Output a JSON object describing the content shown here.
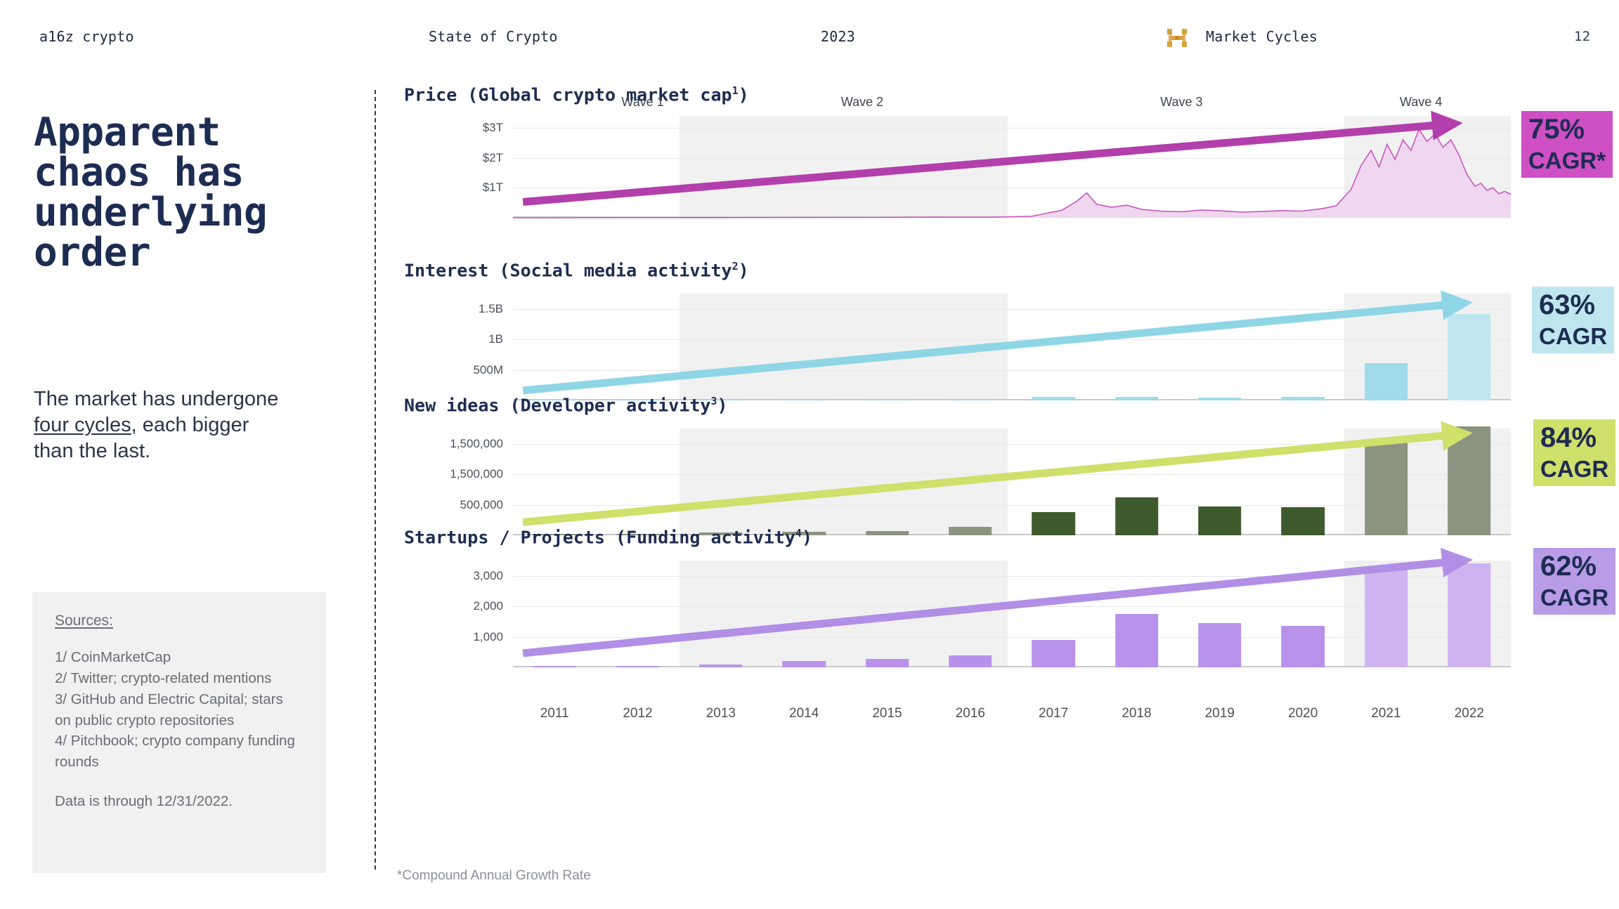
{
  "header": {
    "brand": "a16z crypto",
    "deck": "State of Crypto",
    "year": "2023",
    "section": "Market Cycles",
    "page": "12",
    "logo_icon": "a16z-butterfly-logo-icon",
    "logo_color": "#d8a13f"
  },
  "left": {
    "headline": "Apparent chaos has underlying order",
    "subcopy_pre": "The market has undergone ",
    "subcopy_link": "four cycles",
    "subcopy_post": ", each bigger than the last.",
    "sources_title": "Sources:",
    "sources_list": "1/ CoinMarketCap\n2/ Twitter; crypto-related mentions\n3/ GitHub and Electric Capital; stars on public crypto repositories\n4/ Pitchbook; crypto company funding rounds",
    "sources_note": "Data is through 12/31/2022."
  },
  "footnote": "*Compound Annual Growth Rate",
  "waves": [
    {
      "label": "Wave 1",
      "center_pct": 13.0,
      "shaded": false
    },
    {
      "label": "Wave 2",
      "center_pct": 35.0,
      "shaded": true
    },
    {
      "label": "Wave 3",
      "center_pct": 67.0,
      "shaded": false
    },
    {
      "label": "Wave 4",
      "center_pct": 91.0,
      "shaded": true
    }
  ],
  "xaxis": {
    "categories": [
      "2011",
      "2012",
      "2013",
      "2014",
      "2015",
      "2016",
      "2017",
      "2018",
      "2019",
      "2020",
      "2021",
      "2022"
    ]
  },
  "chart_data": [
    {
      "type": "area",
      "key": "price",
      "title": "Price (Global crypto market cap",
      "title_sup": "1",
      "title_suffix": ")",
      "ylabel": "",
      "yticks": [
        "$3T",
        "$2T",
        "$1T"
      ],
      "ytick_values": [
        3,
        2,
        1
      ],
      "ylim": [
        0,
        3.4
      ],
      "badge": {
        "pct": "75%",
        "cagr": "CAGR*",
        "bg": "#cf4fc4",
        "fg": "#1d2c52"
      },
      "series_color": "#c758be",
      "fill_color": "#f0d6ef",
      "trend_color": "#b23fab",
      "x": [
        "2011",
        "2012",
        "2013",
        "2014",
        "2015",
        "2016",
        "2017",
        "2018",
        "2019",
        "2020",
        "2021",
        "2022"
      ],
      "values_trillions": [
        0.0,
        0.0,
        0.01,
        0.01,
        0.01,
        0.02,
        0.6,
        0.13,
        0.19,
        0.77,
        2.9,
        0.83
      ],
      "peaks": {
        "2018_jan": 0.83,
        "2021_nov": 3.0,
        "2022_dec": 0.83
      }
    },
    {
      "type": "bar",
      "key": "interest",
      "title": "Interest (Social media activity",
      "title_sup": "2",
      "title_suffix": ")",
      "yticks": [
        "1.5B",
        "1B",
        "500M"
      ],
      "ytick_values": [
        1500000000,
        1000000000,
        500000000
      ],
      "ylim": [
        0,
        1750000000
      ],
      "badge": {
        "pct": "63%",
        "cagr": "CAGR",
        "bg": "#bfe6ee",
        "fg": "#1d2c52"
      },
      "bar_color": "#9fdbe8",
      "bar_color_alt": "#bfe6ee",
      "trend_color": "#8ed6e6",
      "categories": [
        "2011",
        "2012",
        "2013",
        "2014",
        "2015",
        "2016",
        "2017",
        "2018",
        "2019",
        "2020",
        "2021",
        "2022"
      ],
      "values": [
        2000000,
        3000000,
        5000000,
        8000000,
        12000000,
        20000000,
        55000000,
        62000000,
        45000000,
        58000000,
        610000000,
        1420000000
      ]
    },
    {
      "type": "bar",
      "key": "new_ideas",
      "title": "New ideas (Developer activity",
      "title_sup": "3",
      "title_suffix": ")",
      "yticks": [
        "1,500,000",
        "1,500,000",
        "500,000"
      ],
      "ytick_values": [
        1500000,
        1000000,
        500000
      ],
      "ylim": [
        0,
        1750000
      ],
      "badge": {
        "pct": "84%",
        "cagr": "CAGR",
        "bg": "#cfe06b",
        "fg": "#1d2c52"
      },
      "bar_color": "#3f5a2c",
      "bar_color_alt": "#8b9480",
      "trend_color": "#cfe06b",
      "categories": [
        "2011",
        "2012",
        "2013",
        "2014",
        "2015",
        "2016",
        "2017",
        "2018",
        "2019",
        "2020",
        "2021",
        "2022"
      ],
      "values": [
        10000,
        25000,
        45000,
        55000,
        75000,
        135000,
        375000,
        620000,
        470000,
        455000,
        1560000,
        1780000
      ]
    },
    {
      "type": "bar",
      "key": "startups",
      "title": "Startups / Projects (Funding activity",
      "title_sup": "4",
      "title_suffix": ")",
      "yticks": [
        "3,000",
        "2,000",
        "1,000"
      ],
      "ytick_values": [
        3000,
        2000,
        1000
      ],
      "ylim": [
        0,
        3500
      ],
      "badge": {
        "pct": "62%",
        "cagr": "CAGR",
        "bg": "#b89ce8",
        "fg": "#1d2c52"
      },
      "bar_color": "#b892ea",
      "bar_color_alt": "#cdb3f0",
      "trend_color": "#b18fe6",
      "categories": [
        "2011",
        "2012",
        "2013",
        "2014",
        "2015",
        "2016",
        "2017",
        "2018",
        "2019",
        "2020",
        "2021",
        "2022"
      ],
      "values": [
        20,
        40,
        90,
        200,
        280,
        400,
        900,
        1750,
        1460,
        1350,
        3200,
        3400
      ]
    }
  ]
}
